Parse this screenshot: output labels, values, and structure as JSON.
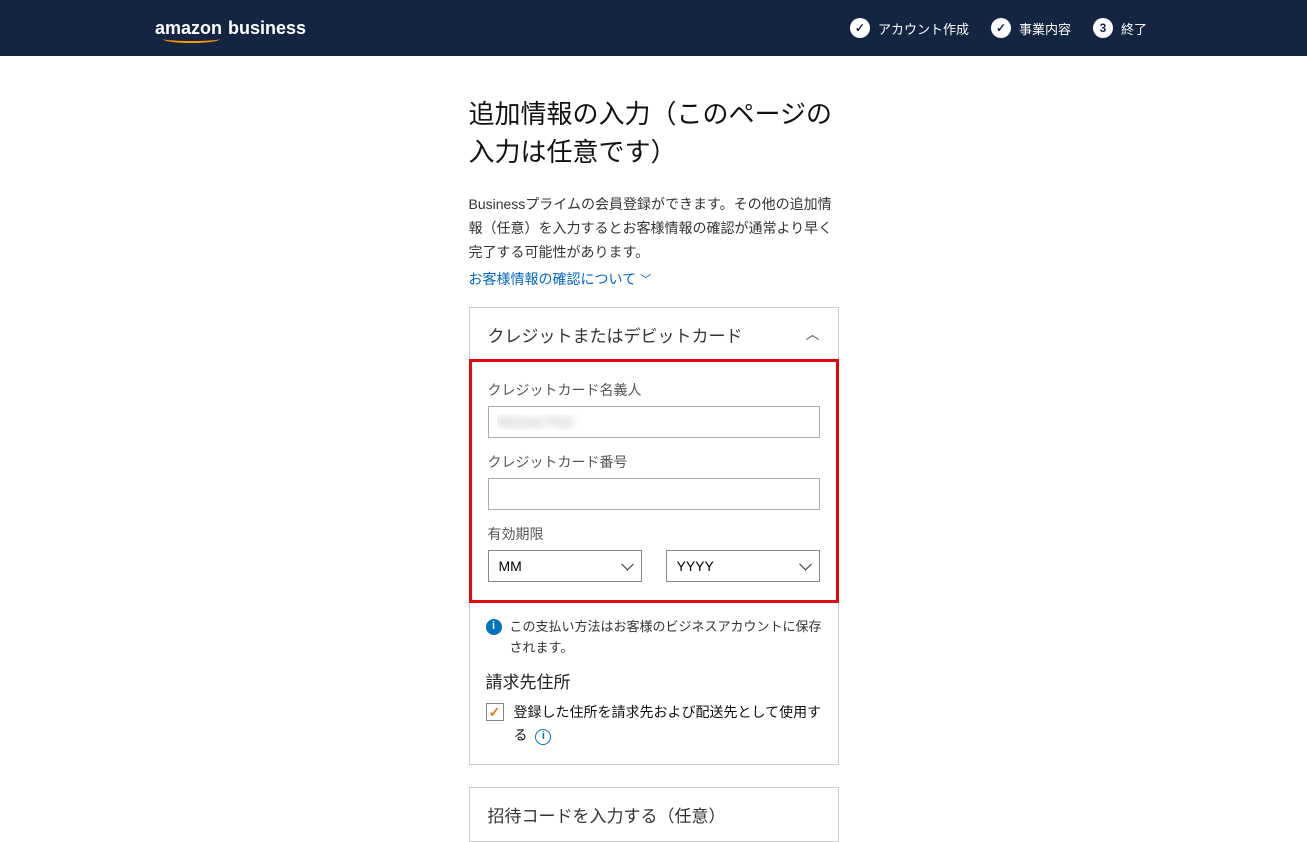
{
  "header": {
    "logo_amazon": "amazon",
    "logo_business": "business",
    "steps": [
      {
        "label": "アカウント作成",
        "state": "done"
      },
      {
        "label": "事業内容",
        "state": "done"
      },
      {
        "label": "終了",
        "state": "current",
        "number": "3"
      }
    ]
  },
  "page": {
    "title": "追加情報の入力（このページの入力は任意です）",
    "description": "Businessプライムの会員登録ができます。その他の追加情報（任意）を入力するとお客様情報の確認が通常より早く完了する可能性があります。",
    "info_link": "お客様情報の確認について"
  },
  "card": {
    "title": "クレジットまたはデビットカード",
    "name_label": "クレジットカード名義人",
    "name_value": "REDACTED",
    "number_label": "クレジットカード番号",
    "number_value": "",
    "expiry_label": "有効期限",
    "month_placeholder": "MM",
    "year_placeholder": "YYYY",
    "info_text": "この支払い方法はお客様のビジネスアカウントに保存されます。",
    "billing_heading": "請求先住所",
    "checkbox_label": "登録した住所を請求先および配送先として使用する"
  },
  "card2": {
    "title": "招待コードを入力する（任意）"
  }
}
